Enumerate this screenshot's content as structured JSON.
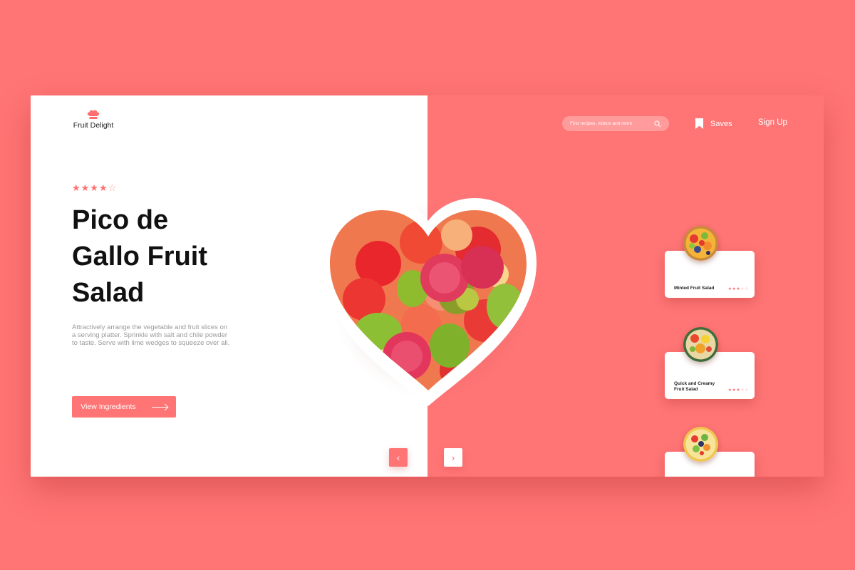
{
  "brand": {
    "name": "Fruit Delight",
    "logo_icon": "chef-hat-icon",
    "accent": "#ff7474"
  },
  "header": {
    "search_placeholder": "Find recipes, videos and more",
    "saves_label": "Saves",
    "signup_label": "Sign Up"
  },
  "hero": {
    "rating_filled": "★★★★",
    "rating_empty": "☆",
    "rating_value": 4,
    "rating_max": 5,
    "title": "Pico de Gallo Fruit Salad",
    "description": "Attractively arrange the vegetable and fruit slices on a serving platter. Sprinkle with salt and chile powder to taste. Serve with lime wedges to squeeze over all.",
    "cta_label": "View Ingredients"
  },
  "carousel": {
    "prev_icon": "‹",
    "next_icon": "›"
  },
  "recipes": [
    {
      "name": "Minted Fruit Salad",
      "stars_filled": "★★★",
      "stars_empty": "☆☆",
      "rating": 3
    },
    {
      "name": "Quick and Creamy Fruit Salad",
      "stars_filled": "★★★",
      "stars_empty": "☆☆",
      "rating": 3
    },
    {
      "name": "",
      "stars_filled": "",
      "stars_empty": "",
      "rating": null
    }
  ]
}
